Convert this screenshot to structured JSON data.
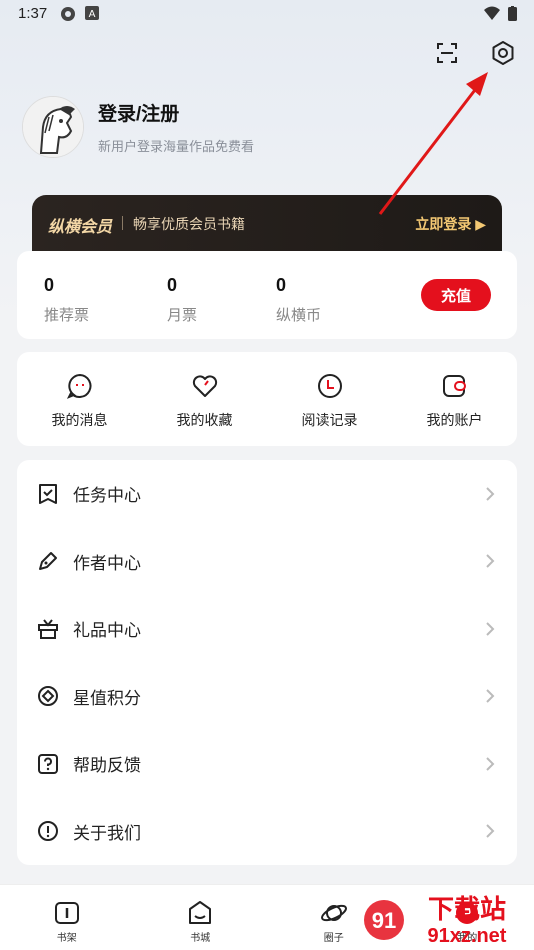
{
  "status_bar": {
    "time": "1:37"
  },
  "profile": {
    "title": "登录/注册",
    "subtitle": "新用户登录海量作品免费看"
  },
  "vip": {
    "brand": "纵横会员",
    "desc": "畅享优质会员书籍",
    "action": "立即登录 ▶"
  },
  "stats": [
    {
      "value": "0",
      "label": "推荐票"
    },
    {
      "value": "0",
      "label": "月票"
    },
    {
      "value": "0",
      "label": "纵横币"
    }
  ],
  "recharge_label": "充值",
  "quick": [
    {
      "label": "我的消息",
      "icon": "message-icon"
    },
    {
      "label": "我的收藏",
      "icon": "heart-icon"
    },
    {
      "label": "阅读记录",
      "icon": "clock-icon"
    },
    {
      "label": "我的账户",
      "icon": "wallet-icon"
    }
  ],
  "menu": [
    {
      "label": "任务中心",
      "icon": "task-icon"
    },
    {
      "label": "作者中心",
      "icon": "pen-icon"
    },
    {
      "label": "礼品中心",
      "icon": "gift-icon"
    },
    {
      "label": "星值积分",
      "icon": "points-icon"
    },
    {
      "label": "帮助反馈",
      "icon": "help-icon"
    },
    {
      "label": "关于我们",
      "icon": "info-icon"
    }
  ],
  "tabs": [
    {
      "label": "书架",
      "icon": "bookshelf-icon"
    },
    {
      "label": "书城",
      "icon": "bookstore-icon"
    },
    {
      "label": "圈子",
      "icon": "planet-icon"
    },
    {
      "label": "我的",
      "icon": "profile-icon"
    }
  ],
  "watermark": {
    "top": "下载站",
    "bottom": "91xz.net"
  },
  "colors": {
    "accent": "#e4101d",
    "vip_gold": "#f3c873"
  }
}
